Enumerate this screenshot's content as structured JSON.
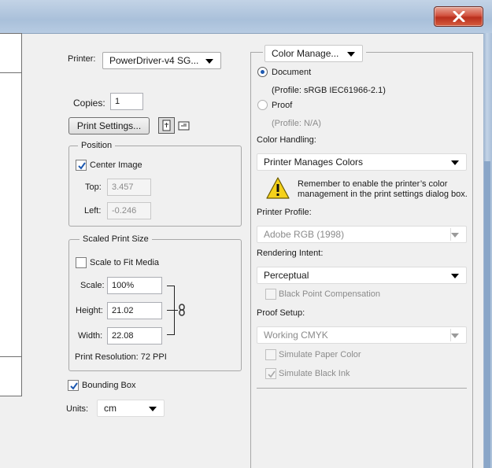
{
  "window": {
    "close_icon": "close-x-icon",
    "close_color": "#c9442e"
  },
  "printer": {
    "label": "Printer:",
    "value": "PowerDriver-v4 SG..."
  },
  "copies": {
    "label": "Copies:",
    "value": "1"
  },
  "print_settings": {
    "button_label": "Print Settings..."
  },
  "orientation": {
    "portrait_icon": "portrait-orientation-icon",
    "landscape_icon": "landscape-orientation-icon"
  },
  "position": {
    "legend": "Position",
    "center_image_label": "Center Image",
    "center_image_checked": true,
    "top_label": "Top:",
    "top_value": "3.457",
    "left_label": "Left:",
    "left_value": "-0.246"
  },
  "scaled_print_size": {
    "legend": "Scaled Print Size",
    "scale_to_fit_label": "Scale to Fit Media",
    "scale_to_fit_checked": false,
    "scale_label": "Scale:",
    "scale_value": "100%",
    "height_label": "Height:",
    "height_value": "21.02",
    "width_label": "Width:",
    "width_value": "22.08",
    "link_icon": "chain-link-icon",
    "resolution_text": "Print Resolution: 72 PPI"
  },
  "bounding_box": {
    "label": "Bounding Box",
    "checked": true
  },
  "units": {
    "label": "Units:",
    "value": "cm"
  },
  "color_management": {
    "section_value": "Color Manage...",
    "document_label": "Document",
    "document_profile": "(Profile: sRGB IEC61966-2.1)",
    "proof_label": "Proof",
    "proof_profile": "(Profile: N/A)",
    "color_handling_label": "Color Handling:",
    "color_handling_value": "Printer Manages Colors",
    "warning_icon": "warning-icon",
    "warning_text_line1": "Remember to enable the printer’s color",
    "warning_text_line2": "management in the print settings dialog box.",
    "printer_profile_label": "Printer Profile:",
    "printer_profile_value": "Adobe RGB (1998)",
    "rendering_intent_label": "Rendering Intent:",
    "rendering_intent_value": "Perceptual",
    "black_point_label": "Black Point Compensation",
    "proof_setup_label": "Proof Setup:",
    "proof_setup_value": "Working CMYK",
    "simulate_paper_label": "Simulate Paper Color",
    "simulate_ink_label": "Simulate Black Ink"
  }
}
